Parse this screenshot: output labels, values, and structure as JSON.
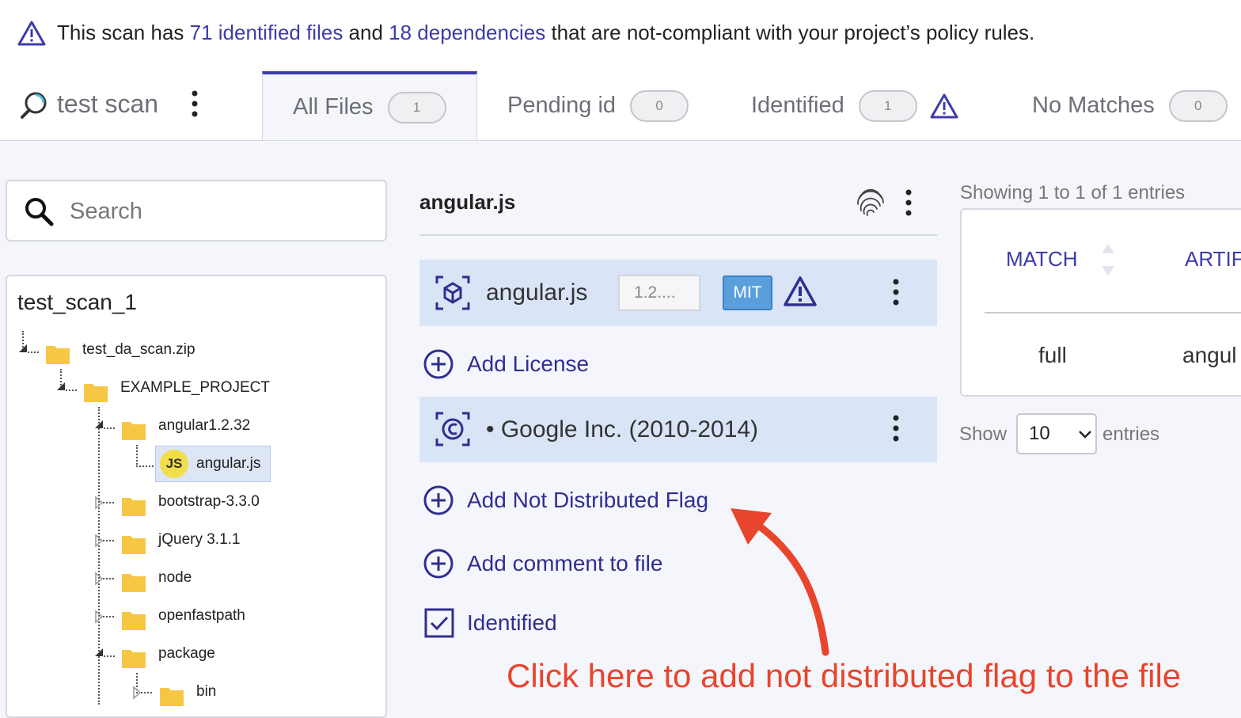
{
  "banner": {
    "prefix": "This scan has ",
    "files_link": "71 identified files",
    "middle": " and ",
    "deps_link": "18 dependencies",
    "suffix": " that are not-compliant with your project’s policy rules.",
    "icon": "warning-triangle-icon"
  },
  "scan": {
    "title": "test scan",
    "icon": "scan-search-icon"
  },
  "tabs": [
    {
      "label": "All Files",
      "count": "1",
      "active": true
    },
    {
      "label": "Pending id",
      "count": "0"
    },
    {
      "label": "Identified",
      "count": "1",
      "warning": true
    },
    {
      "label": "No Matches",
      "count": "0"
    }
  ],
  "search": {
    "placeholder": "Search",
    "value": ""
  },
  "tree": {
    "root": "test_scan_1",
    "nodes": [
      {
        "label": "test_da_scan.zip",
        "type": "folder",
        "expanded": true
      },
      {
        "label": "EXAMPLE_PROJECT",
        "type": "folder",
        "expanded": true
      },
      {
        "label": "angular1.2.32",
        "type": "folder",
        "expanded": true
      },
      {
        "label": "angular.js",
        "type": "file",
        "badge": "JS",
        "selected": true
      },
      {
        "label": "bootstrap-3.3.0",
        "type": "folder",
        "expanded": false
      },
      {
        "label": "jQuery 3.1.1",
        "type": "folder",
        "expanded": false
      },
      {
        "label": "node",
        "type": "folder",
        "expanded": false
      },
      {
        "label": "openfastpath",
        "type": "folder",
        "expanded": false
      },
      {
        "label": "package",
        "type": "folder",
        "expanded": true
      },
      {
        "label": "bin",
        "type": "folder",
        "expanded": false
      }
    ]
  },
  "file": {
    "title": "angular.js",
    "component": {
      "name": "angular.js",
      "version": "1.2....",
      "license": "MIT"
    },
    "actions": {
      "add_license": "Add License",
      "add_not_distributed": "Add Not Distributed Flag",
      "add_comment": "Add comment to file",
      "identified": "Identified"
    },
    "copyright": "• Google Inc. (2010-2014)"
  },
  "matches": {
    "showing": "Showing 1 to 1 of 1 entries",
    "columns": [
      "MATCH",
      "ARTIF"
    ],
    "rows": [
      [
        "full",
        "angul"
      ]
    ],
    "show_label": "Show",
    "page_size": "10",
    "entries_label": "entries"
  },
  "annotation": {
    "text": "Click here to add not distributed flag to the file",
    "color": "#e8452c"
  },
  "colors": {
    "accent": "#3c3ca8",
    "card": "#d9e4f6",
    "warning": "#3c3ca8"
  }
}
